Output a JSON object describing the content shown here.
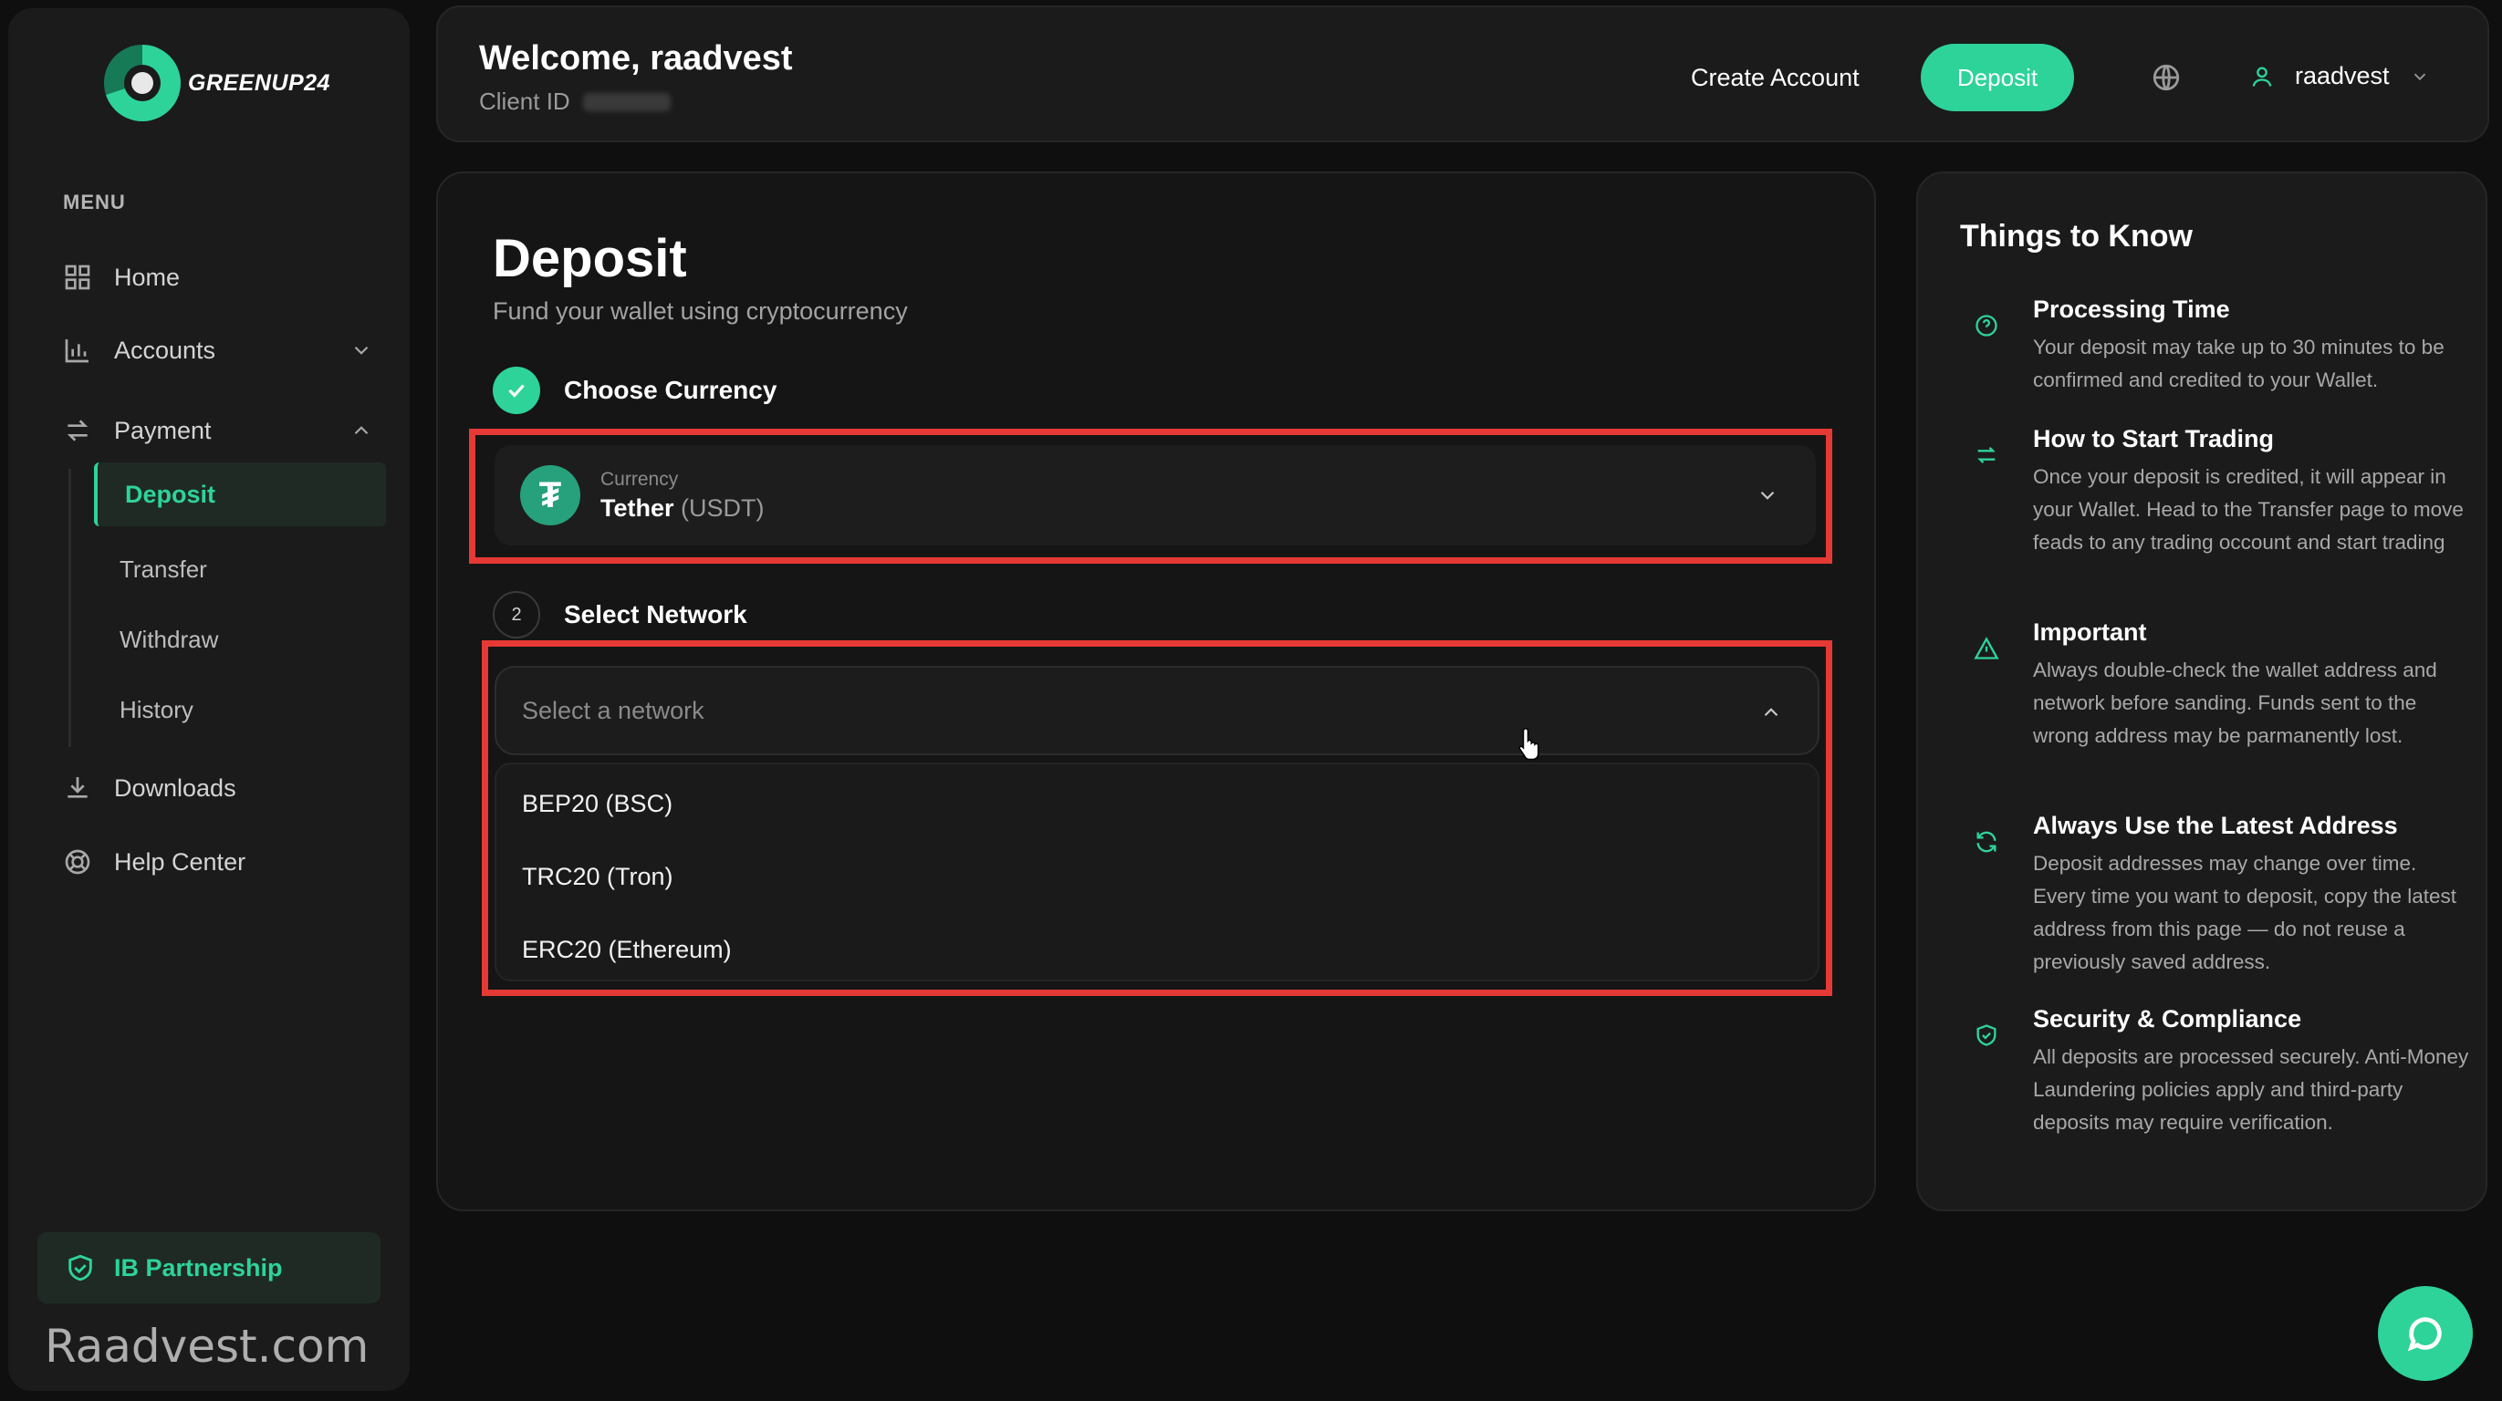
{
  "brand": {
    "name": "GREENUP24"
  },
  "sidebar": {
    "menu_label": "MENU",
    "items": [
      {
        "label": "Home",
        "icon": "grid-icon"
      },
      {
        "label": "Accounts",
        "icon": "bar-chart-icon"
      },
      {
        "label": "Payment",
        "icon": "transfer-arrows-icon"
      },
      {
        "label": "Downloads",
        "icon": "download-icon"
      },
      {
        "label": "Help Center",
        "icon": "lifebuoy-icon"
      }
    ],
    "payment_sub": [
      {
        "label": "Deposit",
        "active": true
      },
      {
        "label": "Transfer"
      },
      {
        "label": "Withdraw"
      },
      {
        "label": "History"
      }
    ],
    "ib_partnership": "IB Partnership",
    "watermark": "Raadvest.com"
  },
  "header": {
    "welcome": "Welcome, raadvest",
    "client_id_label": "Client ID",
    "create_account": "Create Account",
    "deposit_button": "Deposit",
    "username": "raadvest"
  },
  "main": {
    "title": "Deposit",
    "subtitle": "Fund your wallet using cryptocurrency",
    "step1": {
      "label": "Choose Currency",
      "done": true
    },
    "currency": {
      "field_label": "Currency",
      "name": "Tether",
      "code": "(USDT)"
    },
    "step2": {
      "number": "2",
      "label": "Select Network"
    },
    "network": {
      "placeholder": "Select a network",
      "options": [
        "BEP20 (BSC)",
        "TRC20 (Tron)",
        "ERC20 (Ethereum)"
      ]
    }
  },
  "info": {
    "title": "Things to Know",
    "tips": [
      {
        "heading": "Processing Time",
        "body": "Your deposit may take up to 30 minutes to be confirmed and credited to your Wallet.",
        "icon": "question-circle-icon"
      },
      {
        "heading": "How to Start Trading",
        "body": "Once your deposit is credited, it will appear in your Wallet. Head to the Transfer page to move feads to any trading occount and start trading",
        "icon": "swap-icon"
      },
      {
        "heading": "Important",
        "body": "Always double-check the wallet address and network before sanding. Funds sent to the wrong address may be parmanently lost.",
        "icon": "warning-triangle-icon"
      },
      {
        "heading": "Always Use the Latest Address",
        "body": "Deposit addresses may change over time. Every time you want to deposit, copy the latest address from this page — do not reuse a previously saved address.",
        "icon": "refresh-icon"
      },
      {
        "heading": "Security & Compliance",
        "body": "All deposits are processed securely. Anti-Money Laundering policies apply and third-party deposits may require verification.",
        "icon": "shield-check-icon"
      }
    ]
  },
  "colors": {
    "accent": "#2ed39a",
    "highlight": "#e53935",
    "background": "#0f0f0f"
  }
}
